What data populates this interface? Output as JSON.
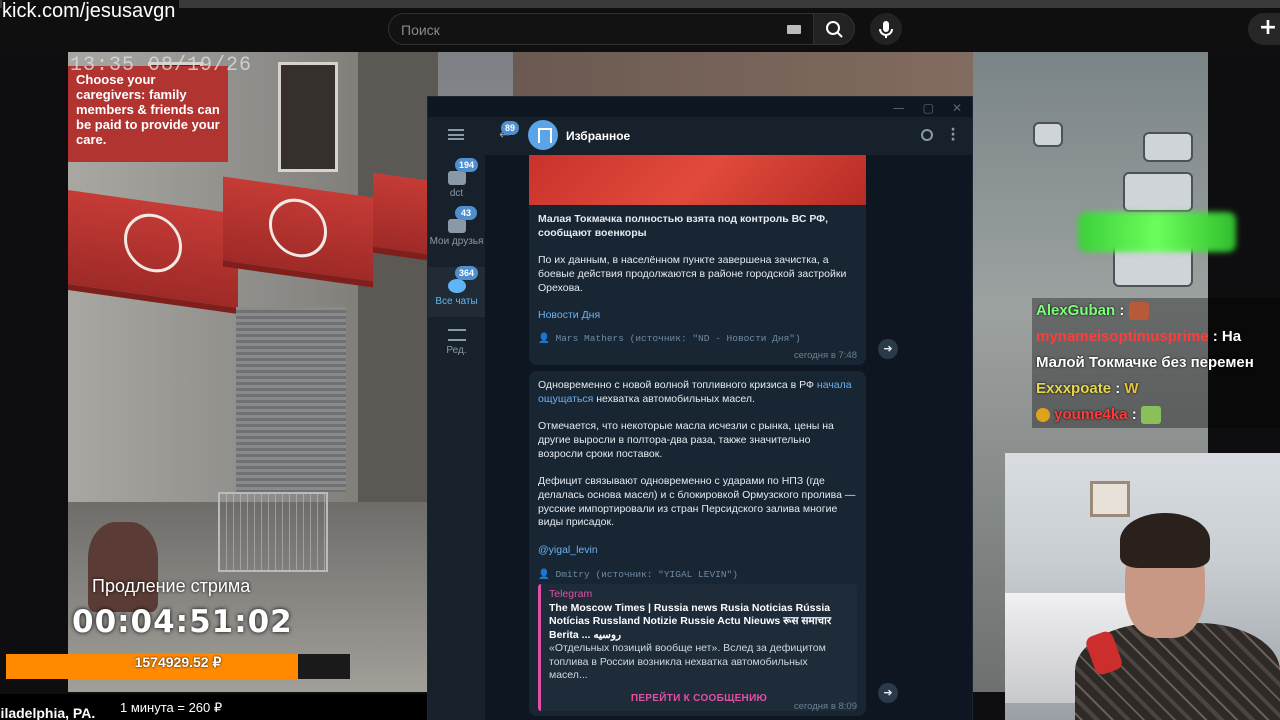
{
  "topbar": {
    "channel_url": "kick.com/jesusavgn",
    "search_placeholder": "Поиск",
    "create_label": "+"
  },
  "cam": {
    "timestamp": "13:35 08/19/26",
    "sign_text": "Choose your caregivers: family members & friends can be paid to provide your care."
  },
  "telegram": {
    "window_buttons": [
      "—",
      "▢",
      "✕"
    ],
    "back_badge": "89",
    "chat_title": "Избранное",
    "folders": [
      {
        "label": "dct",
        "badge": "194"
      },
      {
        "label": "Мои друзья",
        "badge": "43"
      },
      {
        "label": "Все чаты",
        "badge": "364"
      },
      {
        "label": "Ред.",
        "badge": ""
      }
    ],
    "messages": [
      {
        "headline": "Малая Токмачка полностью взята под контроль ВС РФ, сообщают военкоры",
        "body": "По их данным, в населённом пункте завершена зачистка, а боевые действия продолжаются в районе городской застройки Орехова.",
        "channel_link": "Новости Дня",
        "signature": "Mars Mathers (источник: \"ND - Новости Дня\")",
        "time": "сегодня в 7:48"
      },
      {
        "p1_before": "Одновременно с новой волной топливного кризиса в РФ ",
        "p1_link": "начала ощущаться",
        "p1_after": " нехватка автомобильных масел.",
        "p2": "Отмечается, что некоторые масла исчезли с рынка, цены на другие выросли в полтора-два раза, также значительно возросли сроки поставок.",
        "p3": "Дефицит связывают одновременно с ударами по НПЗ (где делалась основа масел) и с блокировкой Ормузского пролива — русские импортировали из стран Персидского залива многие виды присадок.",
        "mention": "@yigal_levin",
        "signature": "Dmitry (источник: \"YIGAL LEVIN\")",
        "preview_site": "Telegram",
        "preview_title": "The Moscow Times | Russia news Rusia Noticias Rússia Notícias Russland Notizie Russie Actu Nieuws रूस समाचार Berita ... روسیه",
        "preview_desc": "«Отдельных позиций вообще нет». Вслед за дефицитом топлива в России возникла нехватка автомобильных масел...",
        "preview_button": "ПЕРЕЙТИ К СООБЩЕНИЮ",
        "time": "сегодня в 8:09"
      }
    ]
  },
  "chat": [
    {
      "user": "AlexGuban",
      "sep": " :",
      "text": ""
    },
    {
      "user": "mynameisoptimusprime",
      "sep": " :",
      "text": " На Малой Токмачке без перемен"
    },
    {
      "user": "Exxxpoate",
      "sep": " :",
      "text": " W"
    },
    {
      "user": "youme4ka",
      "sep": " :",
      "text": ""
    }
  ],
  "stream": {
    "extension_label": "Продление стрима",
    "timer": "00:04:51:02",
    "money": "1574929.52 ₽",
    "money_progress": 0.85,
    "location": "hiladelphia, PA.",
    "rate": "1 минута = 260 ₽"
  },
  "colors": {
    "accent_orange": "#ff8a00",
    "telegram_bg": "#0e1621",
    "telegram_link": "#6ab3f3",
    "preview_accent": "#e24fa3"
  }
}
